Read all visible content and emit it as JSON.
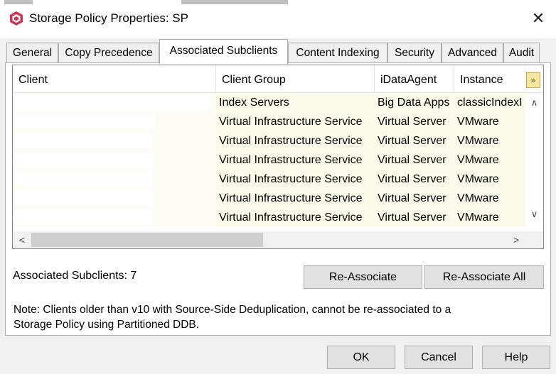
{
  "window": {
    "title": "Storage Policy Properties: SP",
    "close_glyph": "✕",
    "icon": "commvault-logo-icon",
    "accent_color": "#d0344e"
  },
  "tabs": [
    {
      "label": "General"
    },
    {
      "label": "Copy Precedence"
    },
    {
      "label": "Associated Subclients",
      "active": true
    },
    {
      "label": "Content Indexing"
    },
    {
      "label": "Security"
    },
    {
      "label": "Advanced"
    },
    {
      "label": "Audit"
    }
  ],
  "table": {
    "columns": [
      "Client",
      "Client Group",
      "iDataAgent",
      "Instance"
    ],
    "column_picker_glyph": "»",
    "rows": [
      {
        "client": "",
        "client_group": "Index Servers",
        "idataagent": "Big Data Apps",
        "instance": "classicIndexI"
      },
      {
        "client": "",
        "client_group": "Virtual Infrastructure Service",
        "idataagent": "Virtual Server",
        "instance": "VMware"
      },
      {
        "client": "",
        "client_group": "Virtual Infrastructure Service",
        "idataagent": "Virtual Server",
        "instance": "VMware"
      },
      {
        "client": "",
        "client_group": "Virtual Infrastructure Service",
        "idataagent": "Virtual Server",
        "instance": "VMware"
      },
      {
        "client": "",
        "client_group": "Virtual Infrastructure Service",
        "idataagent": "Virtual Server",
        "instance": "VMware"
      },
      {
        "client": "",
        "client_group": "Virtual Infrastructure Service",
        "idataagent": "Virtual Server",
        "instance": "VMware"
      },
      {
        "client": "",
        "client_group": "Virtual Infrastructure Service",
        "idataagent": "Virtual Server",
        "instance": "VMware"
      }
    ],
    "scroll_up_glyph": "∧",
    "scroll_down_glyph": "∨",
    "scroll_left_glyph": "<",
    "scroll_right_glyph": ">"
  },
  "associated_count_label": "Associated Subclients: 7",
  "buttons": {
    "reassociate": "Re-Associate",
    "reassociate_all": "Re-Associate All",
    "ok": "OK",
    "cancel": "Cancel",
    "help": "Help"
  },
  "note": {
    "line1": "Note: Clients older than v10 with Source-Side Deduplication, cannot be re-associated to a",
    "line2": "Storage Policy using Partitioned DDB."
  }
}
